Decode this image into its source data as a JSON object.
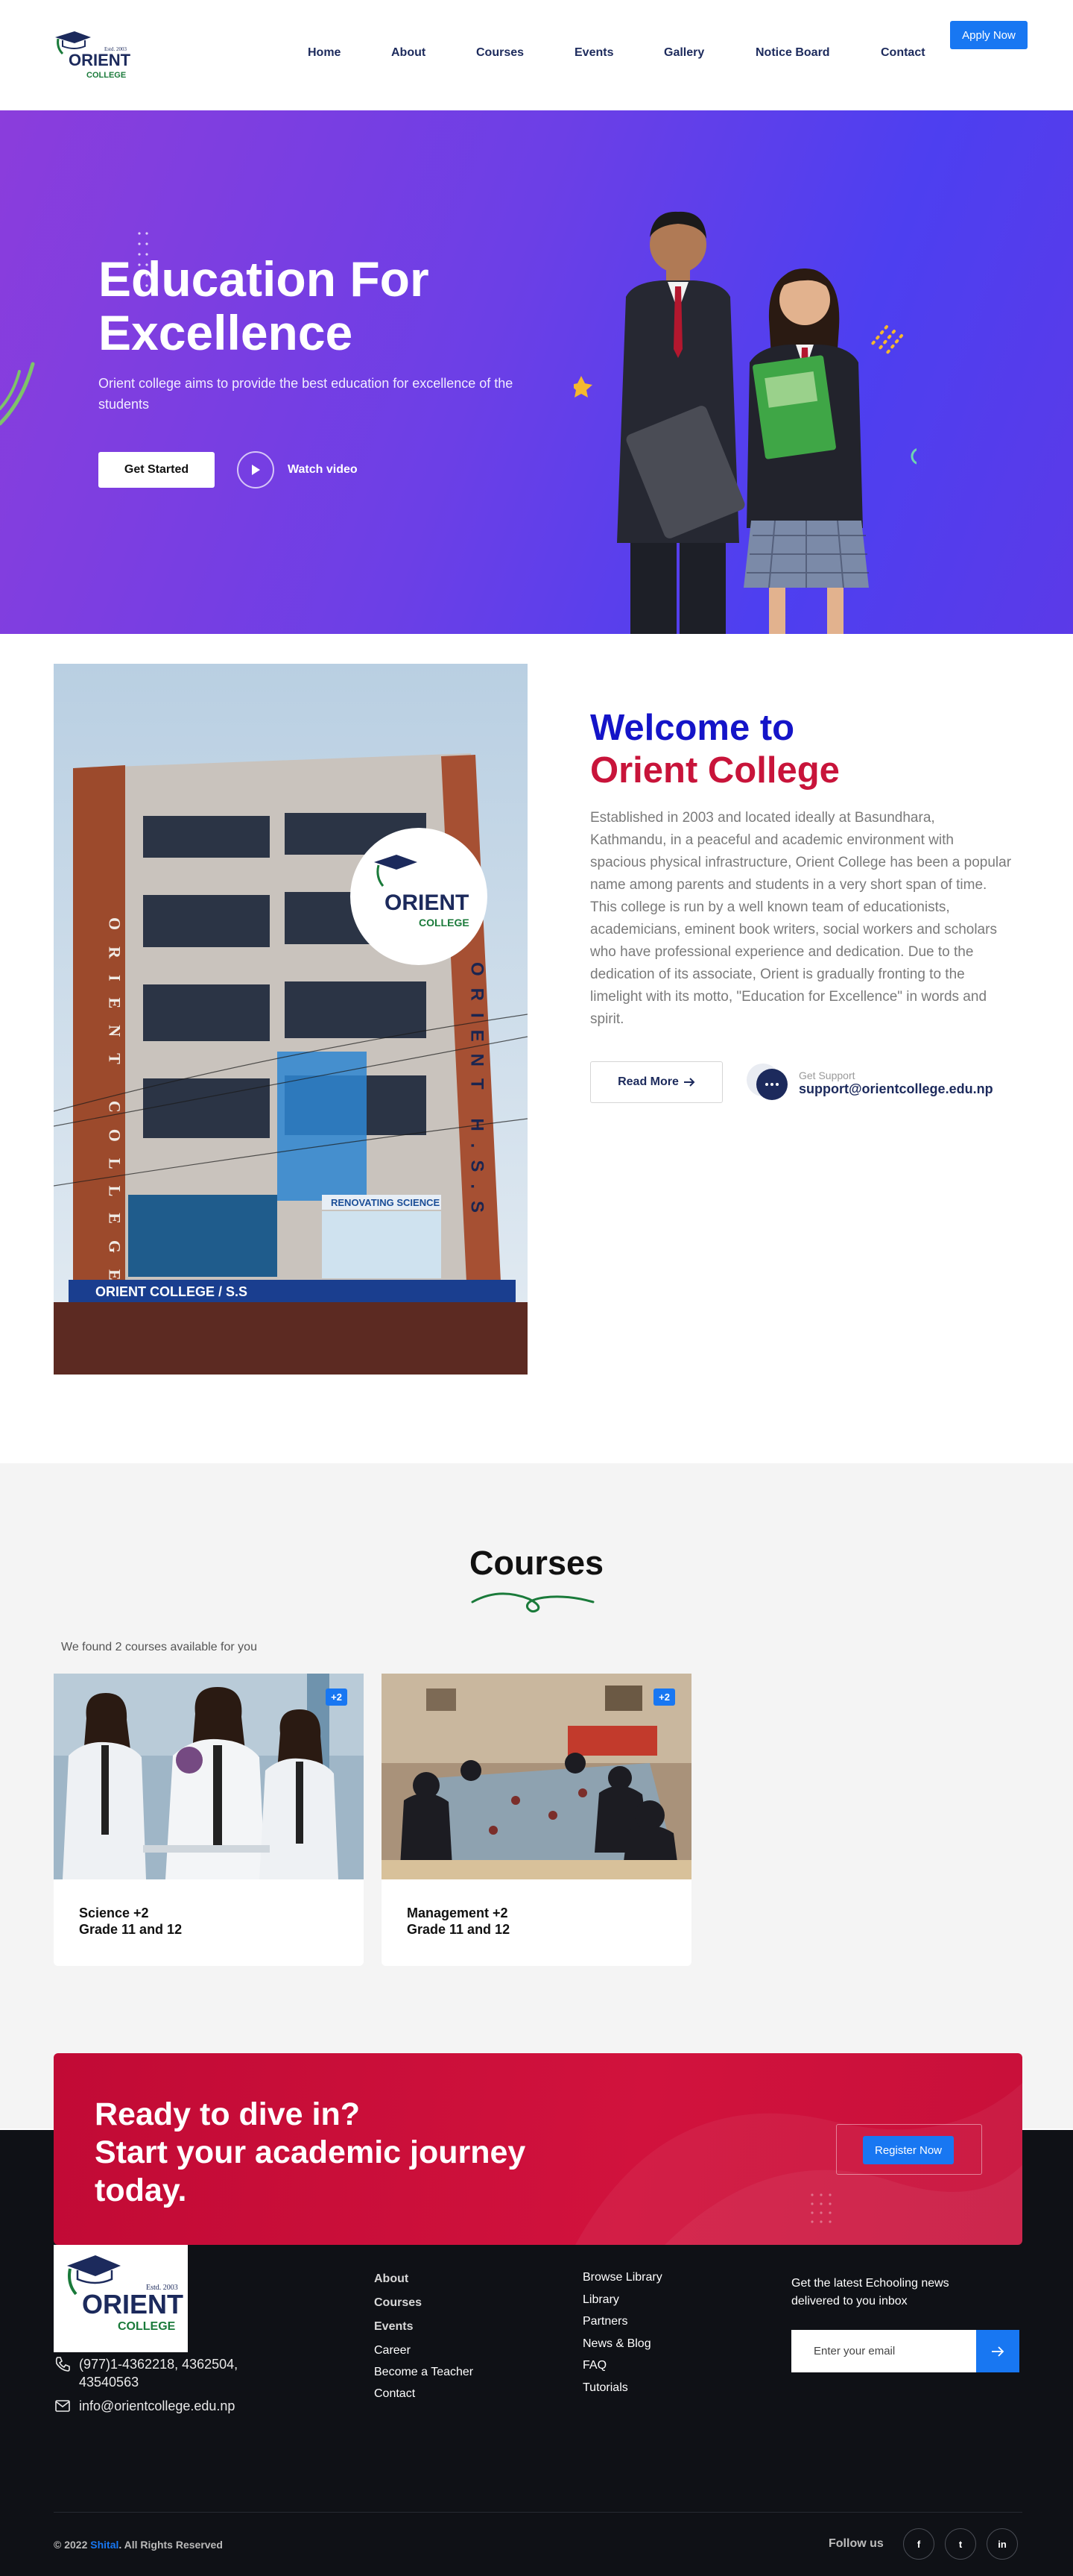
{
  "header": {
    "logo_text": "ORIENT",
    "logo_sub": "COLLEGE",
    "logo_est": "Estd. 2003",
    "nav": [
      "Home",
      "About",
      "Courses",
      "Events",
      "Gallery",
      "Notice Board",
      "Contact"
    ],
    "apply_label": "Apply Now"
  },
  "hero": {
    "title_line1": "Education For",
    "title_line2": "Excellence",
    "subtitle": "Orient college aims to provide the best education for excellence of the students",
    "cta_label": "Get Started",
    "watch_label": "Watch video"
  },
  "welcome": {
    "title_line1": "Welcome to",
    "title_line2": "Orient College",
    "text": "Established in 2003 and located ideally at Basundhara, Kathmandu, in a peaceful and academic environment with spacious physical infrastructure, Orient College has been a popular name among parents and students in a very short span of time. This college is run by a well known team of educationists, academicians, eminent book writers, social workers and scholars who have professional experience and dedication. Due to the dedication of its associate, Orient is gradually fronting to the limelight with its motto, \"Education for Excellence\" in words and spirit.",
    "read_more_label": "Read More",
    "support_label": "Get Support",
    "support_email": "support@orientcollege.edu.np",
    "building_sign_left": "ORIENT COLLEGE",
    "building_sign_right": "ORIENT H.S.S",
    "building_banner": "RENOVATING SCIENCE",
    "building_bottom": "ORIENT COLLEGE / S.S"
  },
  "courses": {
    "title": "Courses",
    "found_text": "We found 2 courses available for you",
    "items": [
      {
        "badge": "+2",
        "line1": "Science +2",
        "line2": "Grade 11 and 12"
      },
      {
        "badge": "+2",
        "line1": "Management +2",
        "line2": "Grade 11 and 12"
      }
    ]
  },
  "cta": {
    "line1": "Ready to dive in?",
    "line2": "Start your academic journey",
    "line3": "today.",
    "button_label": "Register Now"
  },
  "footer": {
    "phone": "(977)1-4362218, 4362504, 43540563",
    "email": "info@orientcollege.edu.np",
    "col1": [
      "About",
      "Courses",
      "Events",
      "Career",
      "Become a Teacher",
      "Contact"
    ],
    "col2": [
      "Browse Library",
      "Library",
      "Partners",
      "News & Blog",
      "FAQ",
      "Tutorials"
    ],
    "newsletter_text": "Get the latest Echooling news delivered to you inbox",
    "email_placeholder": "Enter your email",
    "copyright_prefix": "© 2022",
    "copyright_brand": "Shital",
    "copyright_suffix": ". All Rights Reserved",
    "follow_label": "Follow us",
    "social": [
      "f",
      "t",
      "in"
    ]
  },
  "colors": {
    "primary_blue": "#1877f2",
    "navy": "#1c2a5c",
    "crimson": "#c8143a",
    "royal_blue": "#1414c8",
    "hero_purple": "#6c3fe6",
    "footer_bg": "#0f1116"
  }
}
